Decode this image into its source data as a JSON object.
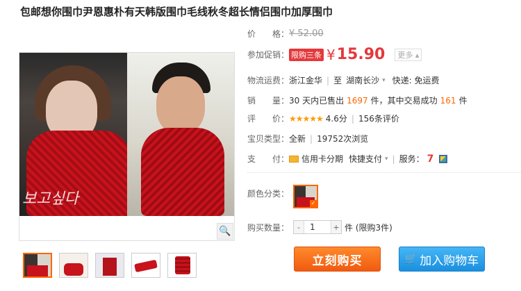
{
  "product": {
    "title": "包邮想你围巾尹恩惠朴有天韩版围巾毛线秋冬超长情侣围巾加厚围巾",
    "image_logo": "보고싶다"
  },
  "price": {
    "label": "价　　格：",
    "original": "¥ 52.00"
  },
  "promo": {
    "label": "参加促销：",
    "tag": "限购三条",
    "currency": "¥",
    "price": "15.90",
    "more": "更多 ▴"
  },
  "shipping": {
    "label": "物流运费：",
    "from": "浙江金华",
    "to_label": "至",
    "to": "湖南长沙",
    "caret": "▾",
    "express": "快递: 免运费"
  },
  "sales": {
    "label": "销　　量：",
    "prefix": "30 天内已售出",
    "sold": "1697",
    "mid": "件，其中交易成功",
    "success": "161",
    "suffix": "件"
  },
  "rating": {
    "label": "评　　价：",
    "stars": "★★★★★",
    "score": "4.6分",
    "reviews": "156条评价"
  },
  "item_type": {
    "label": "宝贝类型：",
    "condition": "全新",
    "views": "19752次浏览"
  },
  "payment": {
    "label": "支　　付：",
    "credit": "信用卡分期",
    "quick": "快捷支付",
    "caret": "▾",
    "service_label": "服务：",
    "service1": "7"
  },
  "color": {
    "label": "颜色分类：",
    "check": "✓"
  },
  "quantity": {
    "label": "购买数量：",
    "minus": "-",
    "value": "1",
    "plus": "+",
    "unit": "件 (限购3件)"
  },
  "buttons": {
    "buy": "立刻购买",
    "cart": "加入购物车",
    "cart_icon": "🛒"
  },
  "zoom_icon": "🔍",
  "colors": {
    "accent": "#e4393c",
    "buy": "#f15a10",
    "cart": "#1a8fe0"
  }
}
